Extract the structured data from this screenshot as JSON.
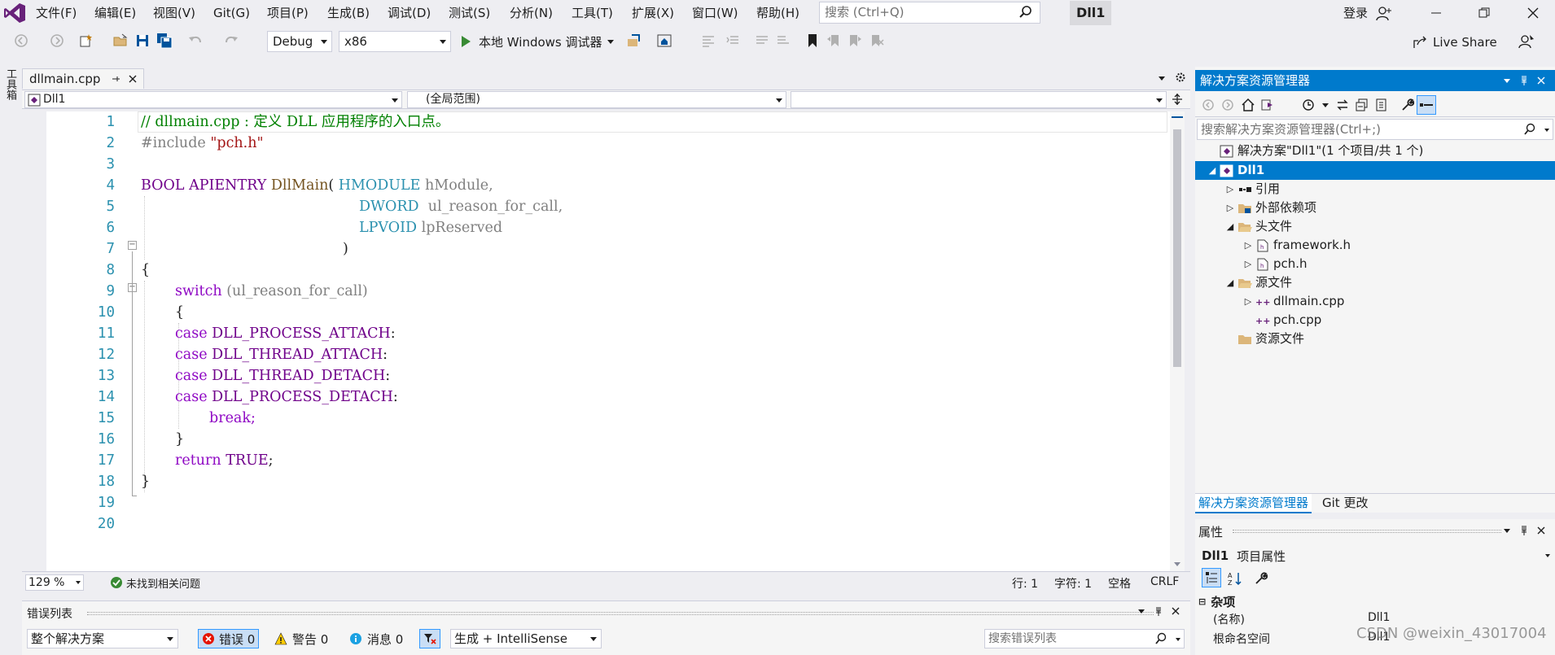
{
  "menu": {
    "items": [
      "文件(F)",
      "编辑(E)",
      "视图(V)",
      "Git(G)",
      "项目(P)",
      "生成(B)",
      "调试(D)",
      "测试(S)",
      "分析(N)",
      "工具(T)",
      "扩展(X)",
      "窗口(W)",
      "帮助(H)"
    ],
    "search_placeholder": "搜索 (Ctrl+Q)",
    "app_title": "Dll1",
    "login": "登录"
  },
  "toolbar": {
    "config": "Debug",
    "platform": "x86",
    "run_label": "本地 Windows 调试器",
    "live_share": "Live Share"
  },
  "left_strip": {
    "label": "工具箱"
  },
  "editor": {
    "tab_label": "dllmain.cpp",
    "nav_project": "Dll1",
    "nav_scope": "(全局范围)",
    "nav_member": "",
    "line_numbers": [
      "1",
      "2",
      "3",
      "4",
      "5",
      "6",
      "7",
      "8",
      "9",
      "10",
      "11",
      "12",
      "13",
      "14",
      "15",
      "16",
      "17",
      "18",
      "19",
      "20"
    ],
    "code": {
      "l1": "// dllmain.cpp : 定义 DLL 应用程序的入口点。",
      "l2_a": "#include ",
      "l2_b": "\"pch.h\"",
      "l4_a": "BOOL APIENTRY ",
      "l4_b": "DllMain",
      "l4_c": "( ",
      "l4_d": "HMODULE",
      "l4_e": " hModule,",
      "l5_a": "DWORD",
      "l5_b": "  ul_reason_for_call,",
      "l6_a": "LPVOID",
      "l6_b": " lpReserved",
      "l7": ")",
      "l8": "{",
      "l9_a": "switch",
      "l9_b": " (ul_reason_for_call)",
      "l10": "{",
      "l11_a": "case ",
      "l11_b": "DLL_PROCESS_ATTACH",
      "l11_c": ":",
      "l12_a": "case ",
      "l12_b": "DLL_THREAD_ATTACH",
      "l12_c": ":",
      "l13_a": "case ",
      "l13_b": "DLL_THREAD_DETACH",
      "l13_c": ":",
      "l14_a": "case ",
      "l14_b": "DLL_PROCESS_DETACH",
      "l14_c": ":",
      "l15": "break;",
      "l16": "}",
      "l17_a": "return ",
      "l17_b": "TRUE",
      "l17_c": ";",
      "l18": "}"
    },
    "status": {
      "zoom": "129 %",
      "issues": "未找到相关问题",
      "line": "行: 1",
      "char": "字符: 1",
      "ws": "空格",
      "eol": "CRLF"
    }
  },
  "error_list": {
    "title": "错误列表",
    "scope": "整个解决方案",
    "errors": "错误 0",
    "warnings": "警告 0",
    "messages": "消息 0",
    "source": "生成 + IntelliSense",
    "search_placeholder": "搜索错误列表"
  },
  "solution_explorer": {
    "title": "解决方案资源管理器",
    "search_placeholder": "搜索解决方案资源管理器(Ctrl+;)",
    "tree": [
      {
        "label": "解决方案\"Dll1\"(1 个项目/共 1 个)"
      },
      {
        "label": "Dll1"
      },
      {
        "label": "引用"
      },
      {
        "label": "外部依赖项"
      },
      {
        "label": "头文件"
      },
      {
        "label": "framework.h"
      },
      {
        "label": "pch.h"
      },
      {
        "label": "源文件"
      },
      {
        "label": "dllmain.cpp"
      },
      {
        "label": "pch.cpp"
      },
      {
        "label": "资源文件"
      }
    ],
    "tabs": [
      "解决方案资源管理器",
      "Git 更改"
    ]
  },
  "properties": {
    "title": "属性",
    "object": "Dll1",
    "object_type": "项目属性",
    "category": "杂项",
    "rows": [
      {
        "name": "(名称)",
        "value": "Dll1"
      },
      {
        "name": "根命名空间",
        "value": "Dll1"
      }
    ]
  },
  "watermark": "CSDN @weixin_43017004",
  "colors": {
    "accent": "#007ACC",
    "comment": "#008000",
    "keyword": "#0000FF",
    "type": "#2B91AF",
    "macro": "#6F008A",
    "control": "#8F08C4",
    "string": "#A31515"
  }
}
